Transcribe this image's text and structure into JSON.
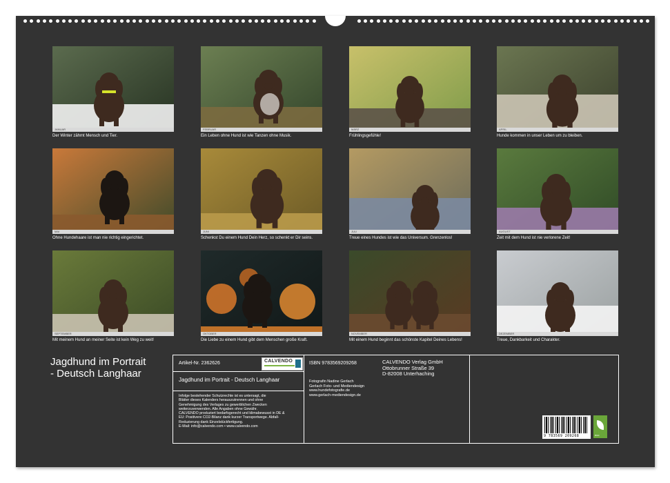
{
  "calendar": {
    "title_line1": "Jagdhund im Portrait",
    "title_line2": "- Deutsch Langhaar"
  },
  "months": [
    {
      "label": "JANUAR",
      "caption": "Der Winter zähmt Mensch und Tier."
    },
    {
      "label": "FEBRUAR",
      "caption": "Ein Leben ohne Hund ist wie Tanzen ohne Musik."
    },
    {
      "label": "MÄRZ",
      "caption": "Frühlingsgefühle!"
    },
    {
      "label": "APRIL",
      "caption": "Hunde kommen in unser Leben um zu bleiben."
    },
    {
      "label": "MAI",
      "caption": "Ohne Hundehaare ist man nie richtig eingerichtet."
    },
    {
      "label": "JUNI",
      "caption": "Schenkst Du einem Hund Dein Herz, so schenkt er Dir seins."
    },
    {
      "label": "JULI",
      "caption": "Treue eines Hundes ist wie das Universum. Grenzenlos!"
    },
    {
      "label": "AUGUST",
      "caption": "Zeit mit dem Hund ist nie verlorene Zeit!"
    },
    {
      "label": "SEPTEMBER",
      "caption": "Mit meinem Hund an meiner Seite ist kein Weg zu weit!"
    },
    {
      "label": "OKTOBER",
      "caption": "Die Liebe zu einem Hund gibt dem Menschen große Kraft."
    },
    {
      "label": "NOVEMBER",
      "caption": "Mit einem Hund beginnt das schönste Kapitel Deines Lebens!"
    },
    {
      "label": "DEZEMBER",
      "caption": "Treue, Dankbarkeit und Charakter."
    }
  ],
  "info": {
    "article": "Artikel-Nr. 2362626",
    "logo_text": "CALVENDO",
    "product_title": "Jagdhund im Portrait - Deutsch Langhaar",
    "legal": [
      "Infolge bestehender Schutzrechte ist es untersagt, die",
      "Blätter dieses Kalenders herauszutrennen und ohne",
      "Genehmigung des Verlages zu gewerblichen Zwecken",
      "weiterzuverwenden. Alle Angaben ohne Gewähr.",
      "CALVENDO produziert bedarfsgerecht und klimabewusst in DE &",
      "EU: Positivere CO2-Bilanz dank kurzer Transportwege. Abfall-",
      "Reduzierung dank Einzelstückfertigung.",
      "E-Mail: info@calvendo.com • www.calvendo.com"
    ],
    "isbn": "ISBN 9783569209268",
    "photographer": [
      "Fotografin Nadine Gerlach",
      "Gerlach Foto- und Mediendesign",
      "www.hundefotografie.de",
      "www.gerlach-mediendesign.de"
    ],
    "publisher": [
      "CALVENDO Verlag GmbH",
      "Ottobrunner Straße 39",
      "D-82008 Unterhaching"
    ],
    "barcode_number": "9 783569 209268",
    "eco_label": "eco"
  },
  "colors": {
    "page_background": "#333333",
    "text": "#ffffff",
    "dog_brown": "#3e2a1f",
    "eco_green": "#6aa63a"
  }
}
